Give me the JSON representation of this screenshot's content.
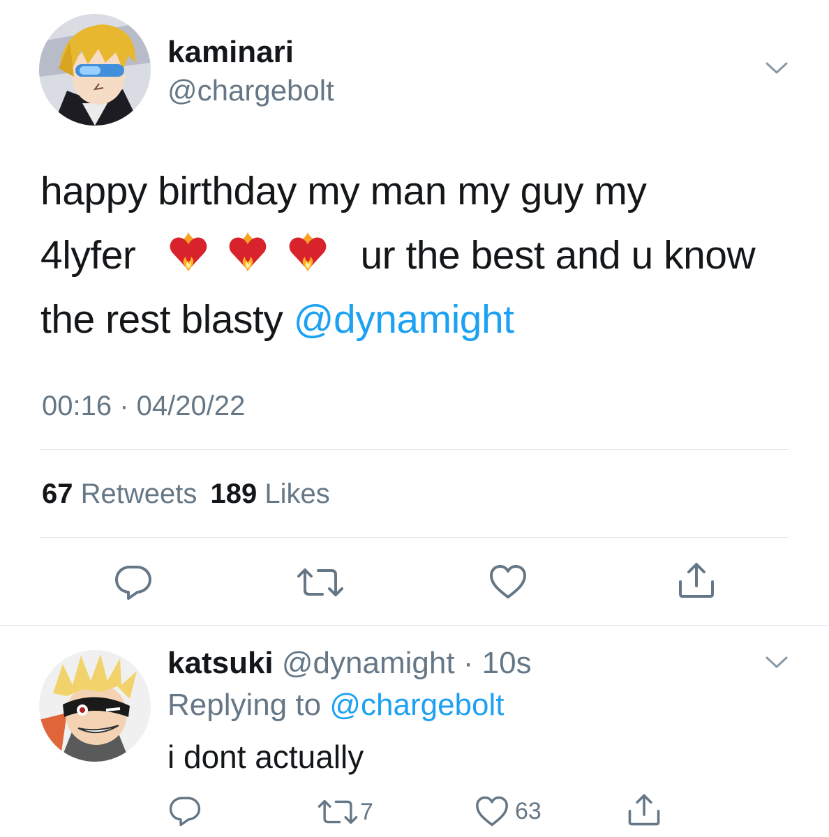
{
  "tweet": {
    "author_name": "kaminari",
    "author_handle": "@chargebolt",
    "text_line1": "happy birthday my man my guy my",
    "text_line2_start": "4lyfer",
    "text_line2_end": "ur the best and u know",
    "text_line3_start": "the rest blasty ",
    "mention": "@dynamight",
    "emoji": [
      "fire-heart",
      "fire-heart",
      "fire-heart"
    ],
    "timestamp": "00:16 · 04/20/22",
    "retweets_count": "67",
    "retweets_label": "Retweets",
    "likes_count": "189",
    "likes_label": "Likes"
  },
  "reply": {
    "author_name": "katsuki",
    "author_handle_time": "@dynamight · 10s",
    "replying_label": "Replying to ",
    "replying_handle": "@chargebolt",
    "text": "i dont actually",
    "retweet_count": "7",
    "like_count": "63"
  },
  "icons": {
    "reply": "speech-bubble-icon",
    "retweet": "retweet-icon",
    "like": "heart-icon",
    "share": "share-icon",
    "more": "chevron-down-icon"
  },
  "colors": {
    "link": "#1da1f2",
    "secondary": "#657786",
    "text": "#14171a",
    "divider": "#e1e8ed"
  }
}
